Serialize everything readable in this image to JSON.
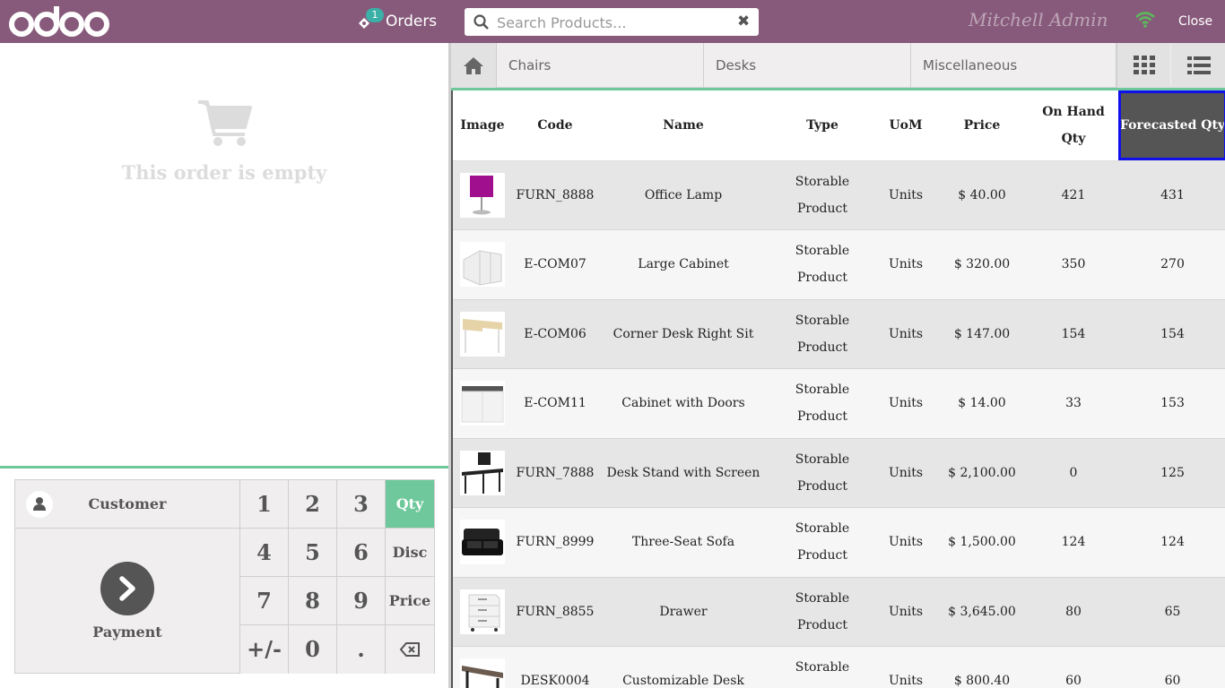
{
  "header": {
    "orders_count": "1",
    "orders_label": "Orders",
    "search_placeholder": "Search Products...",
    "cashier": "Mitchell Admin",
    "close_label": "Close",
    "brand_color": "#875a7b"
  },
  "order": {
    "empty_message": "This order is empty"
  },
  "actionpad": {
    "customer_label": "Customer",
    "payment_label": "Payment"
  },
  "numpad": {
    "keys": [
      "1",
      "2",
      "3",
      "Qty",
      "4",
      "5",
      "6",
      "Disc",
      "7",
      "8",
      "9",
      "Price",
      "+/-",
      "0",
      ".",
      "backspace"
    ],
    "active_mode": "Qty"
  },
  "categories": [
    "Chairs",
    "Desks",
    "Miscellaneous"
  ],
  "table": {
    "columns": [
      "Image",
      "Code",
      "Name",
      "Type",
      "UoM",
      "Price",
      "On Hand Qty",
      "Forecasted Qty"
    ],
    "rows": [
      {
        "code": "FURN_8888",
        "name": "Office Lamp",
        "type": "Storable Product",
        "uom": "Units",
        "price": "$ 40.00",
        "on_hand": "421",
        "forecast": "431",
        "img": "lamp"
      },
      {
        "code": "E-COM07",
        "name": "Large Cabinet",
        "type": "Storable Product",
        "uom": "Units",
        "price": "$ 320.00",
        "on_hand": "350",
        "forecast": "270",
        "img": "cabinet"
      },
      {
        "code": "E-COM06",
        "name": "Corner Desk Right Sit",
        "type": "Storable Product",
        "uom": "Units",
        "price": "$ 147.00",
        "on_hand": "154",
        "forecast": "154",
        "img": "desk"
      },
      {
        "code": "E-COM11",
        "name": "Cabinet with Doors",
        "type": "Storable Product",
        "uom": "Units",
        "price": "$ 14.00",
        "on_hand": "33",
        "forecast": "153",
        "img": "doors"
      },
      {
        "code": "FURN_7888",
        "name": "Desk Stand with Screen",
        "type": "Storable Product",
        "uom": "Units",
        "price": "$ 2,100.00",
        "on_hand": "0",
        "forecast": "125",
        "img": "stand"
      },
      {
        "code": "FURN_8999",
        "name": "Three-Seat Sofa",
        "type": "Storable Product",
        "uom": "Units",
        "price": "$ 1,500.00",
        "on_hand": "124",
        "forecast": "124",
        "img": "sofa"
      },
      {
        "code": "FURN_8855",
        "name": "Drawer",
        "type": "Storable Product",
        "uom": "Units",
        "price": "$ 3,645.00",
        "on_hand": "80",
        "forecast": "65",
        "img": "drawer"
      },
      {
        "code": "DESK0004",
        "name": "Customizable Desk",
        "type": "Storable Product",
        "uom": "Units",
        "price": "$ 800.40",
        "on_hand": "60",
        "forecast": "60",
        "img": "cdesk"
      }
    ]
  }
}
